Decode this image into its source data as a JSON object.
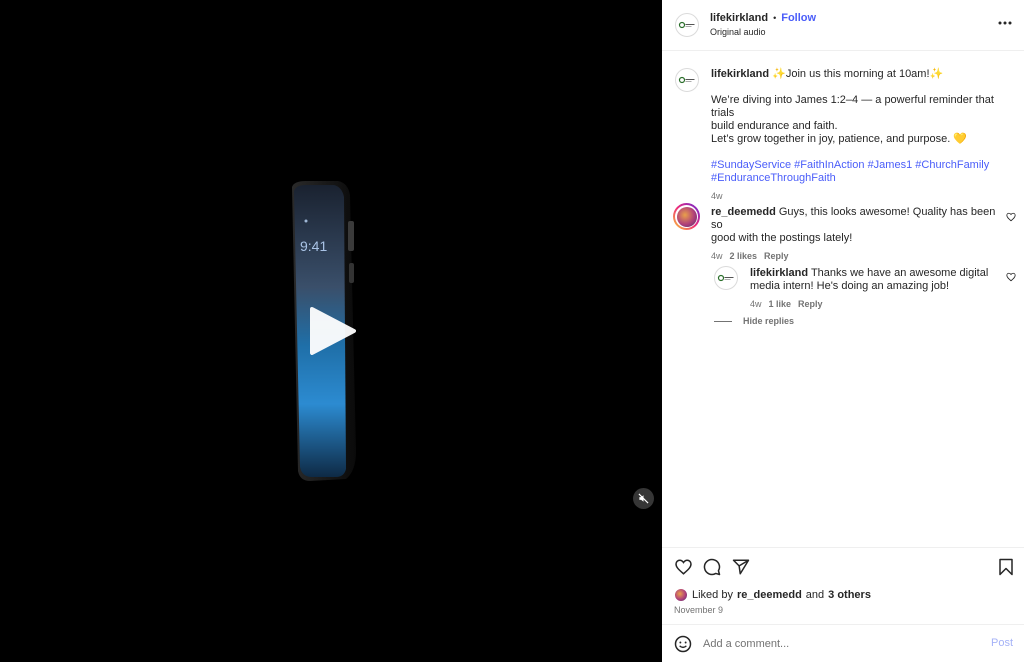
{
  "header": {
    "username": "lifekirkland",
    "separator": "•",
    "follow_label": "Follow",
    "audio_label": "Original audio",
    "more_icon": "more-horizontal-icon"
  },
  "caption": {
    "username": "lifekirkland",
    "line1": "✨Join us this morning at 10am!✨",
    "line2": "We’re diving into James 1:2–4 — a powerful reminder that trials",
    "line3": "build endurance and faith.",
    "line4": "Let’s grow together in joy, patience, and purpose. 💛",
    "hashtags": [
      "#SundayService",
      "#FaithInAction",
      "#James1",
      "#ChurchFamily",
      "#EnduranceThroughFaith"
    ],
    "time": "4w"
  },
  "comments": [
    {
      "username": "re_deemedd",
      "text_line1": "Guys, this looks awesome! Quality has been so",
      "text_line2": "good with the postings lately!",
      "time": "4w",
      "likes": "2 likes",
      "reply_label": "Reply"
    }
  ],
  "reply": {
    "username": "lifekirkland",
    "text_line1": "Thanks we have an awesome digital",
    "text_line2": "media intern! He's doing an amazing job!",
    "time": "4w",
    "likes": "1 like",
    "reply_label": "Reply",
    "hide_replies_label": "Hide replies"
  },
  "actions": {
    "icons": [
      "heart-icon",
      "comment-icon",
      "share-icon",
      "bookmark-icon"
    ]
  },
  "likes": {
    "prefix": "Liked by",
    "user": "re_deemedd",
    "middle": "and",
    "others": "3 others"
  },
  "date": "November 9",
  "comment_box": {
    "placeholder": "Add a comment...",
    "post_label": "Post"
  },
  "colors": {
    "link_blue": "#4a5df9",
    "text": "#262626",
    "muted": "#737373",
    "post_disabled": "#a5b2f7"
  }
}
